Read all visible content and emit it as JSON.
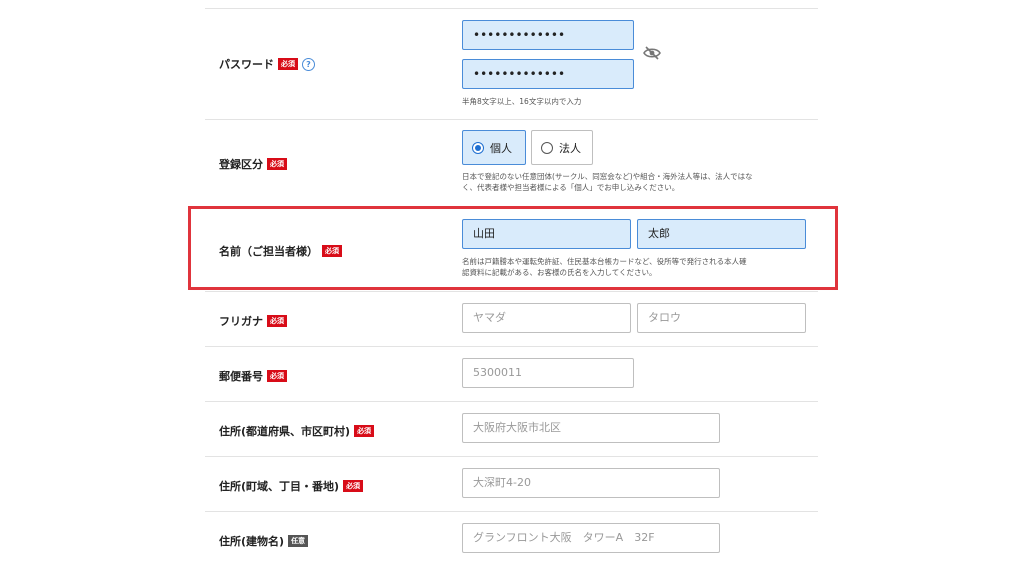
{
  "required_badge": "必須",
  "optional_badge": "任意",
  "password": {
    "label": "パスワード",
    "help_icon": "?",
    "value_masked": "•••••••••••••",
    "confirm_masked": "•••••••••••••",
    "eye_icon": "eye-slash-icon",
    "note": "半角8文字以上、16文字以内で入力"
  },
  "registration_type": {
    "label": "登録区分",
    "options": [
      {
        "label": "個人",
        "selected": true
      },
      {
        "label": "法人",
        "selected": false
      }
    ],
    "note_line1": "日本で登記のない任意団体(サークル、同窓会など)や組合・海外法人等は、法人ではな",
    "note_line2": "く、代表者様や担当者様による「個人」でお申し込みください。"
  },
  "name": {
    "label": "名前（ご担当者様）",
    "last_value": "山田",
    "first_value": "太郎",
    "note_line1": "名前は戸籍謄本や運転免許証、住民基本台帳カードなど、役所等で発行される本人確",
    "note_line2": "認資料に記載がある、お客様の氏名を入力してください。"
  },
  "furigana": {
    "label": "フリガナ",
    "last_placeholder": "ヤマダ",
    "first_placeholder": "タロウ"
  },
  "postal_code": {
    "label": "郵便番号",
    "placeholder": "5300011"
  },
  "address_pref": {
    "label": "住所(都道府県、市区町村)",
    "placeholder": "大阪府大阪市北区"
  },
  "address_town": {
    "label": "住所(町域、丁目・番地)",
    "placeholder": "大深町4-20"
  },
  "address_building": {
    "label": "住所(建物名)",
    "placeholder": "グランフロント大阪　タワーA　32F"
  },
  "colors": {
    "required_badge": "#d80c18",
    "filled_input_bg": "#d9ebfb",
    "focus_border": "#4a8cd8",
    "highlight_border": "#e0343c"
  }
}
